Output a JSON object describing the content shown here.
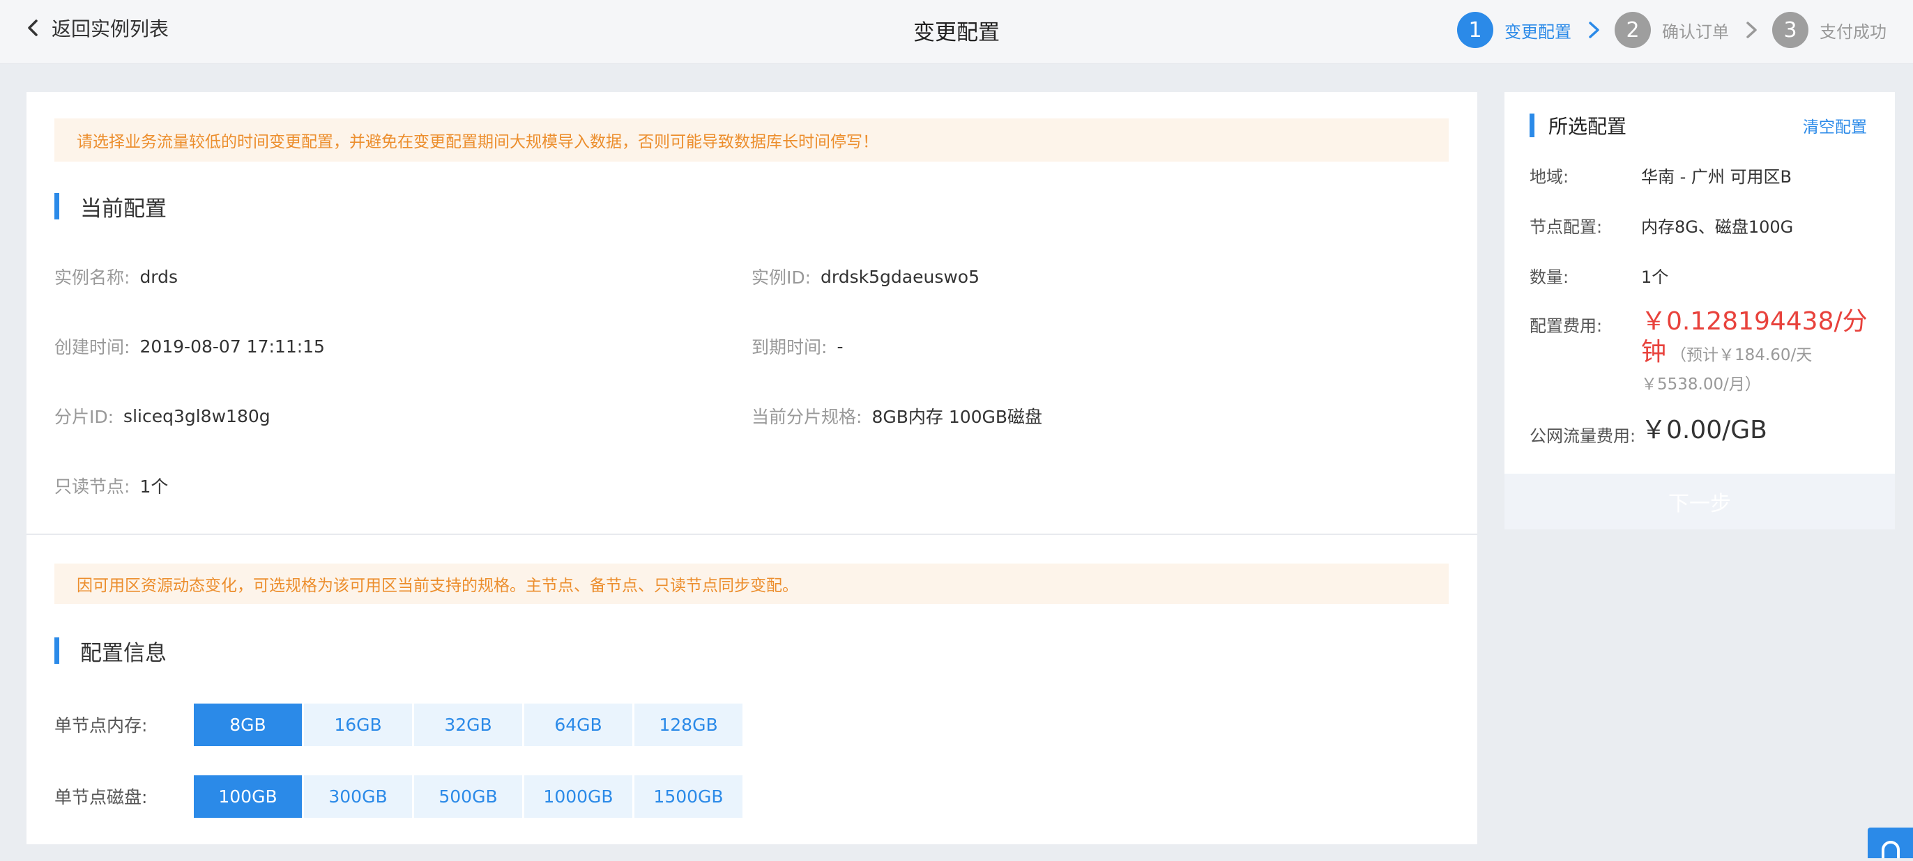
{
  "topbar": {
    "back_label": "返回实例列表",
    "title": "变更配置",
    "steps": [
      {
        "num": "1",
        "label": "变更配置"
      },
      {
        "num": "2",
        "label": "确认订单"
      },
      {
        "num": "3",
        "label": "支付成功"
      }
    ]
  },
  "main": {
    "alert1": "请选择业务流量较低的时间变更配置，并避免在变更配置期间大规模导入数据，否则可能导致数据库长时间停写！",
    "current_title": "当前配置",
    "info": {
      "name_label": "实例名称:",
      "name_value": "drds",
      "id_label": "实例ID:",
      "id_value": "drdsk5gdaeuswo5",
      "created_label": "创建时间:",
      "created_value": "2019-08-07 17:11:15",
      "expire_label": "到期时间:",
      "expire_value": "-",
      "shard_label": "分片ID:",
      "shard_value": "sliceq3gl8w180g",
      "spec_label": "当前分片规格:",
      "spec_value": "8GB内存 100GB磁盘",
      "readonly_label": "只读节点:",
      "readonly_value": "1个"
    },
    "alert2": "因可用区资源动态变化，可选规格为该可用区当前支持的规格。主节点、备节点、只读节点同步变配。",
    "config_title": "配置信息",
    "memory": {
      "label": "单节点内存:",
      "options": [
        "8GB",
        "16GB",
        "32GB",
        "64GB",
        "128GB"
      ],
      "selected": "8GB"
    },
    "disk": {
      "label": "单节点磁盘:",
      "options": [
        "100GB",
        "300GB",
        "500GB",
        "1000GB",
        "1500GB"
      ],
      "selected": "100GB"
    }
  },
  "summary": {
    "title": "所选配置",
    "clear_label": "清空配置",
    "region_label": "地域:",
    "region_value": "华南 - 广州 可用区B",
    "node_label": "节点配置:",
    "node_value": "内存8G、磁盘100G",
    "qty_label": "数量:",
    "qty_value": "1个",
    "fee_label": "配置费用:",
    "fee_line1": "￥0.128194438/分",
    "fee_line2_big": "钟",
    "fee_line2_sub": "（预计￥184.60/天",
    "fee_line3_sub": "￥5538.00/月）",
    "traffic_label": "公网流量费用:",
    "traffic_value": "￥0.00/GB",
    "next_label": "下一步"
  },
  "colors": {
    "accent": "#2b8ae8",
    "warning_text": "#ec8e2d",
    "warning_bg": "#fdf4ea",
    "price": "#e8423c"
  }
}
